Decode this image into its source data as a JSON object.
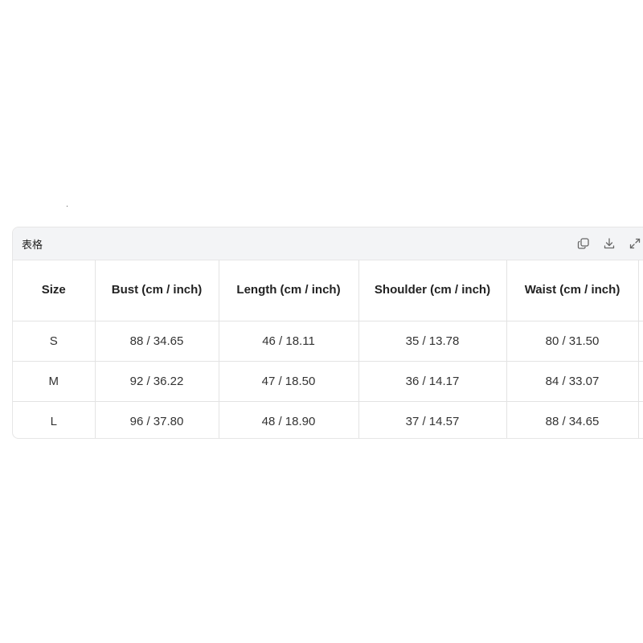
{
  "card": {
    "title": "表格",
    "icons": [
      "copy-icon",
      "download-icon",
      "expand-icon"
    ]
  },
  "table": {
    "headers": [
      "Size",
      "Bust (cm / inch)",
      "Length (cm / inch)",
      "Shoulder (cm / inch)",
      "Waist (cm / inch)"
    ],
    "rows": [
      [
        "S",
        "88 / 34.65",
        "46 / 18.11",
        "35 / 13.78",
        "80 / 31.50"
      ],
      [
        "M",
        "92 / 36.22",
        "47 / 18.50",
        "36 / 14.17",
        "84 / 33.07"
      ],
      [
        "L",
        "96 / 37.80",
        "48 / 18.90",
        "37 / 14.57",
        "88 / 34.65"
      ]
    ]
  },
  "colors": {
    "header_bg": "#f3f4f6",
    "border": "#e3e3e3",
    "text": "#222222"
  }
}
